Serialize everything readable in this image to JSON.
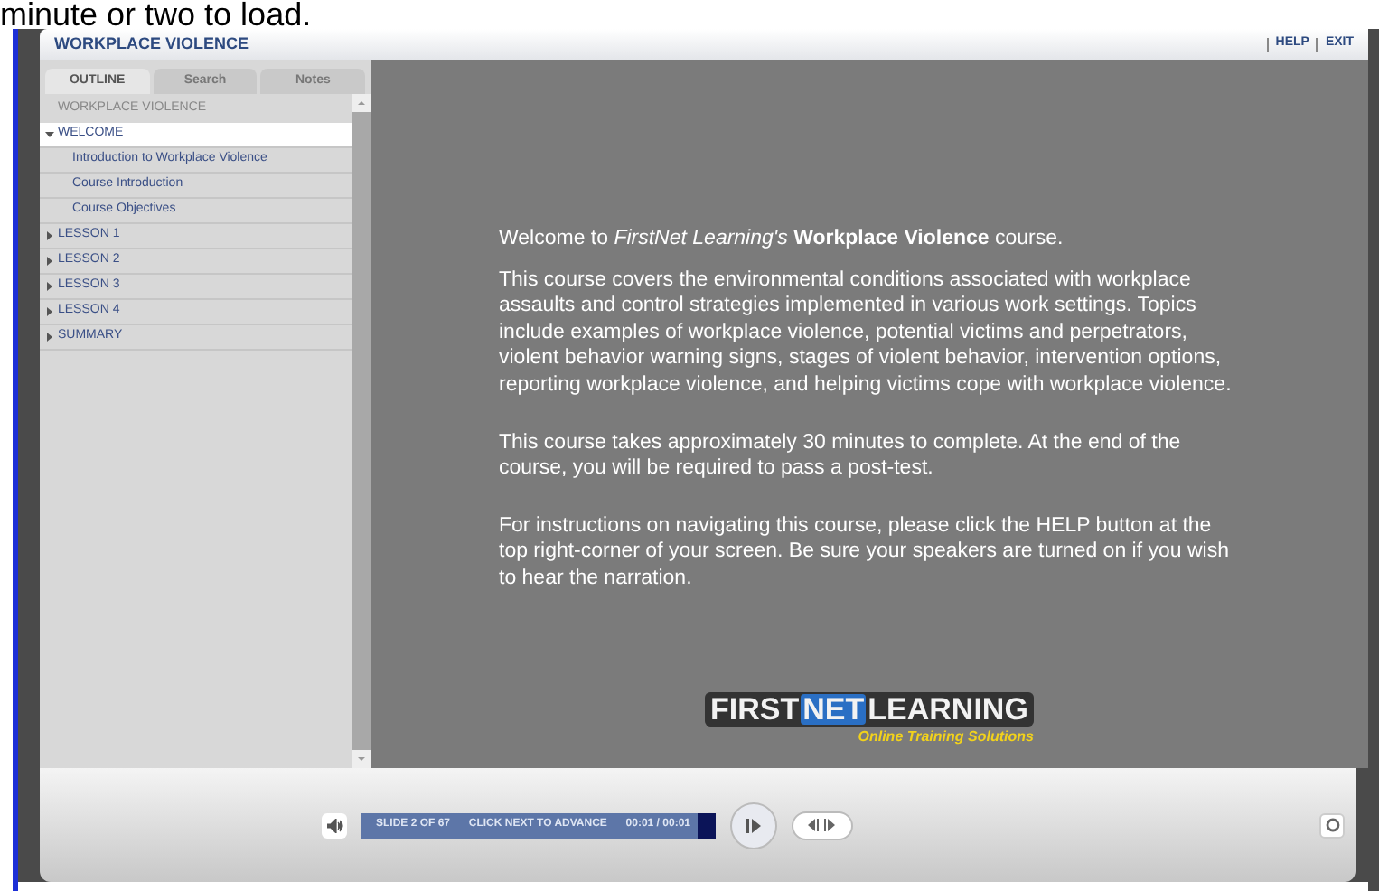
{
  "page_text": "minute or two to load.",
  "header": {
    "title": "WORKPLACE VIOLENCE",
    "links": [
      "HELP",
      "EXIT"
    ]
  },
  "tabs": [
    {
      "label": "OUTLINE",
      "selected": true
    },
    {
      "label": "Search",
      "selected": false
    },
    {
      "label": "Notes",
      "selected": false
    }
  ],
  "outline": {
    "title": "WORKPLACE VIOLENCE",
    "items": [
      {
        "label": "WELCOME",
        "expanded": true,
        "selected": true,
        "children": [
          {
            "label": "Introduction to Workplace Violence"
          },
          {
            "label": "Course Introduction"
          },
          {
            "label": "Course Objectives"
          }
        ]
      },
      {
        "label": "LESSON 1",
        "expanded": false,
        "selected": false
      },
      {
        "label": "LESSON 2",
        "expanded": false,
        "selected": false
      },
      {
        "label": "LESSON 3",
        "expanded": false,
        "selected": false
      },
      {
        "label": "LESSON 4",
        "expanded": false,
        "selected": false
      },
      {
        "label": "SUMMARY",
        "expanded": false,
        "selected": false
      }
    ]
  },
  "slide": {
    "paragraphs": [
      "Welcome to *FirstNet Learning's* **Workplace Violence** course.",
      "This course covers the environmental conditions associated with workplace assaults and control strategies implemented in various work settings. Topics include examples of workplace violence, potential victims and perpetrators, violent behavior warning signs, stages of violent behavior, intervention options, reporting workplace violence, and helping victims cope with workplace violence.",
      "This course takes approximately 30 minutes to complete. At the end of the course, you will be required to pass a post-test.",
      "For instructions on navigating this course, please click the HELP button at the top right-corner of your screen. Be sure your speakers are turned on if you wish to hear the narration."
    ],
    "logo": {
      "parts": [
        "FIRST",
        "NET",
        "LEARNING"
      ],
      "tagline": "Online Training Solutions"
    }
  },
  "player": {
    "slide": "SLIDE 2 OF 67",
    "hint": "CLICK NEXT TO ADVANCE",
    "time": "00:01 / 00:01",
    "level": 0.95
  }
}
